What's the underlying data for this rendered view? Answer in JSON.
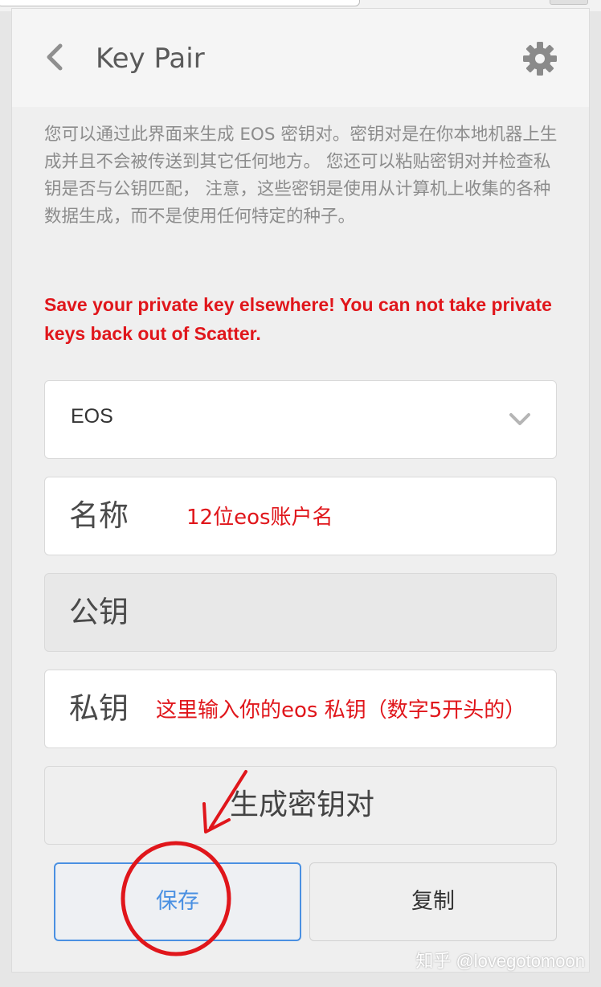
{
  "header": {
    "title": "Key Pair"
  },
  "icons": {
    "back": "chevron-left-icon",
    "settings": "gear-icon",
    "dropdown": "chevron-down-icon"
  },
  "description": "您可以通过此界面来生成 EOS 密钥对。密钥对是在你本地机器上生成并且不会被传送到其它任何地方。 您还可以粘贴密钥对并检查私钥是否与公钥匹配， 注意，这些密钥是使用从计算机上收集的各种数据生成，而不是使用任何特定的种子。",
  "warning": "Save your private key elsewhere! You can not take private keys back out of Scatter.",
  "form": {
    "blockchain_select": {
      "value": "EOS"
    },
    "name_field": {
      "placeholder": "名称",
      "annotation": "12位eos账户名"
    },
    "public_key_field": {
      "placeholder": "公钥"
    },
    "private_key_field": {
      "placeholder": "私钥",
      "annotation": "这里输入你的eos 私钥（数字5开头的）"
    },
    "generate_button": "生成密钥对"
  },
  "actions": {
    "save": "保存",
    "copy": "复制"
  },
  "watermark": "知乎 @lovegotomoon",
  "colors": {
    "accent": "#4a90e2",
    "annotation_red": "#e0161b",
    "text_gray": "#8c8c8c"
  }
}
